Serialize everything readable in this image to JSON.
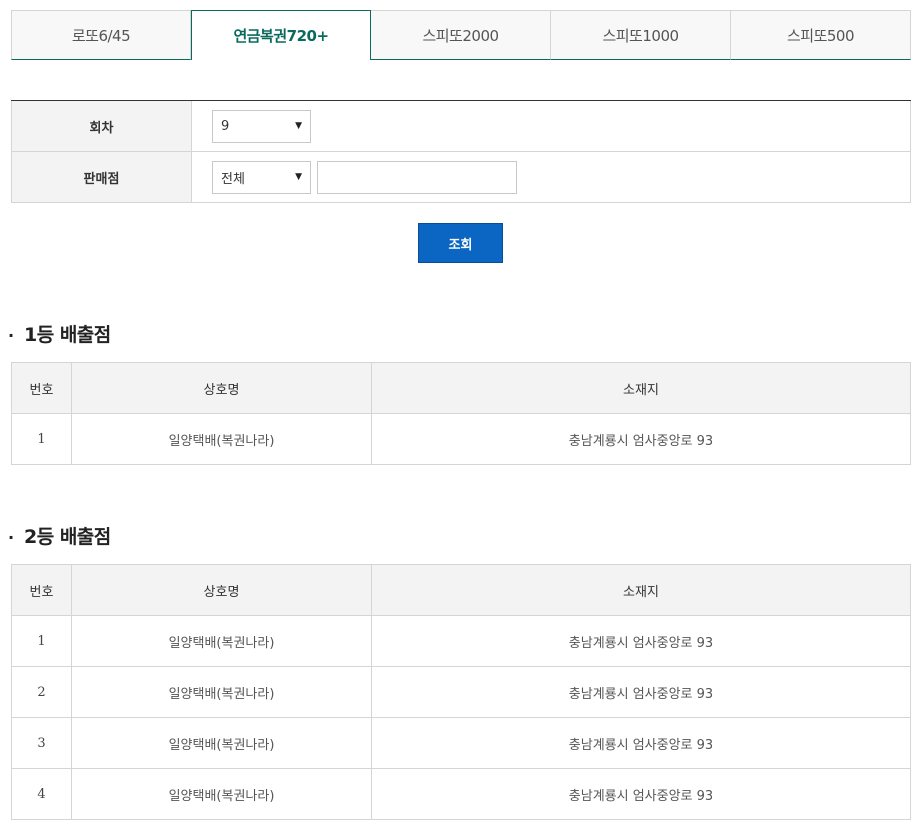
{
  "tabs": [
    {
      "label": "로또6/45",
      "active": false
    },
    {
      "label": "연금복권720+",
      "active": true
    },
    {
      "label": "스피또2000",
      "active": false
    },
    {
      "label": "스피또1000",
      "active": false
    },
    {
      "label": "스피또500",
      "active": false
    }
  ],
  "search": {
    "round_label": "회차",
    "round_value": "9",
    "store_label": "판매점",
    "store_value": "전체",
    "store_keyword": "",
    "button_label": "조회"
  },
  "first_prize": {
    "title": "1등 배출점",
    "headers": {
      "no": "번호",
      "name": "상호명",
      "address": "소재지"
    },
    "rows": [
      {
        "no": "1",
        "name": "일양택배(복권나라)",
        "address": "충남계룡시 엄사중앙로 93"
      }
    ]
  },
  "second_prize": {
    "title": "2등 배출점",
    "headers": {
      "no": "번호",
      "name": "상호명",
      "address": "소재지"
    },
    "rows": [
      {
        "no": "1",
        "name": "일양택배(복권나라)",
        "address": "충남계룡시 엄사중앙로 93"
      },
      {
        "no": "2",
        "name": "일양택배(복권나라)",
        "address": "충남계룡시 엄사중앙로 93"
      },
      {
        "no": "3",
        "name": "일양택배(복권나라)",
        "address": "충남계룡시 엄사중앙로 93"
      },
      {
        "no": "4",
        "name": "일양택배(복권나라)",
        "address": "충남계룡시 엄사중앙로 93"
      }
    ]
  },
  "icons": {
    "dropdown": "triangle-down-icon",
    "bullet": "bullet-dot-icon"
  }
}
